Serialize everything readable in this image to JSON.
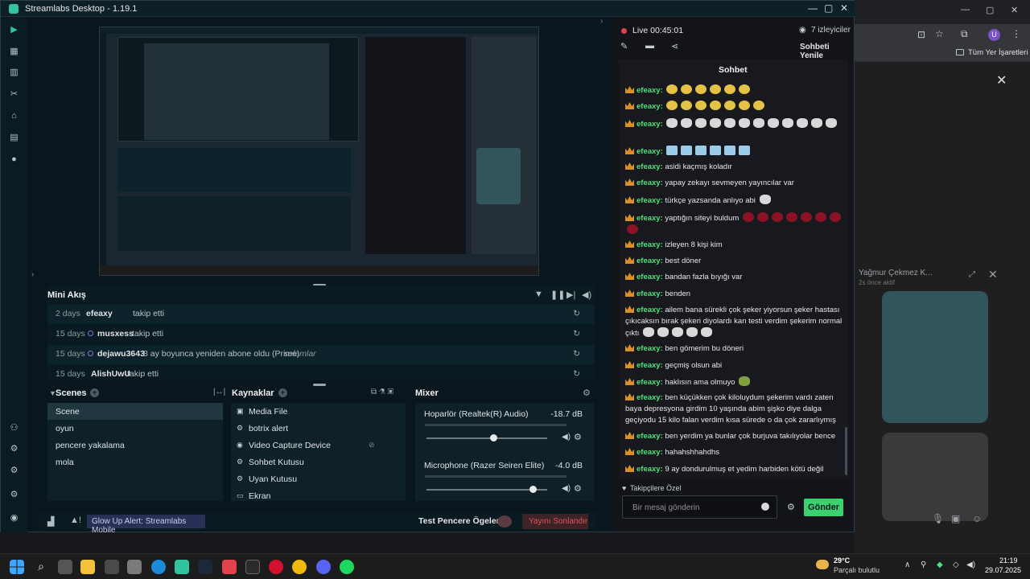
{
  "browser": {
    "bookmarks_label": "Tüm Yer İşaretleri",
    "profile_letter": "U",
    "card_title": "Yağmur Çekmez K...",
    "card_sub": "2s önce aktif"
  },
  "app": {
    "title": "Streamlabs Desktop - 1.19.1"
  },
  "minifeed": {
    "title": "Mini Akış",
    "rows": [
      {
        "age": "2 days",
        "user": "efeaxy",
        "action": "takip etti",
        "extra": ""
      },
      {
        "age": "15 days",
        "user": "musxess",
        "action": "takip etti",
        "extra": ""
      },
      {
        "age": "15 days",
        "user": "dejawu3643",
        "action": "8 ay boyunca yeniden abone oldu (Prime)",
        "extra": "selamlar"
      },
      {
        "age": "15 days",
        "user": "AlishUwU",
        "action": "takip etti",
        "extra": ""
      }
    ]
  },
  "scenes": {
    "title": "Scenes",
    "items": [
      "Scene",
      "oyun",
      "pencere yakalama",
      "mola"
    ],
    "selected": 0
  },
  "sources": {
    "title": "Kaynaklar",
    "items": [
      "Media File",
      "botrix alert",
      "Video Capture Device",
      "Sohbet Kutusu",
      "Uyan Kutusu",
      "Ekran"
    ]
  },
  "mixer": {
    "title": "Mixer",
    "channels": [
      {
        "name": "Hoparlör (Realtek(R) Audio)",
        "db": "-18.7 dB",
        "level": 0.55
      },
      {
        "name": "Microphone (Razer Seiren Elite)",
        "db": "-4.0 dB",
        "level": 0.88
      }
    ]
  },
  "footer": {
    "alert": "Glow Up Alert: Streamlabs Mobile",
    "test_label": "Test Pencere Ögeleri",
    "end_stream": "Yayını Sonlandır"
  },
  "stream": {
    "live": "Live 00:45:01",
    "viewers": "7 izleyiciler",
    "refresh": "Sohbeti Yenile",
    "chat_title": "Sohbet",
    "followers_only": "Takipçilere Özel",
    "input_placeholder": "Bir mesaj gönderin",
    "send": "Gönder"
  },
  "chat": [
    {
      "user": "efeaxy:",
      "text": "",
      "emotes": "yellow",
      "count": 6
    },
    {
      "user": "efeaxy:",
      "text": "",
      "emotes": "yellow",
      "count": 7
    },
    {
      "user": "efeaxy:",
      "text": "",
      "emotes": "duck",
      "count": 12
    },
    {
      "user": "efeaxy:",
      "text": "",
      "emotes": "peep",
      "count": 6
    },
    {
      "user": "efeaxy:",
      "text": "asidi kaçmış koladır",
      "emotes": "",
      "count": 0
    },
    {
      "user": "efeaxy:",
      "text": "yapay zekayı sevmeyen yayıncılar var",
      "emotes": "",
      "count": 0
    },
    {
      "user": "efeaxy:",
      "text": "türkçe yazsanda anlıyo abi",
      "emotes": "duck",
      "count": 1
    },
    {
      "user": "efeaxy:",
      "text": "yaptığın siteyi buldum",
      "emotes": "red",
      "count": 8
    },
    {
      "user": "efeaxy:",
      "text": "izleyen 8 kişi kim",
      "emotes": "",
      "count": 0
    },
    {
      "user": "efeaxy:",
      "text": "best döner",
      "emotes": "",
      "count": 0
    },
    {
      "user": "efeaxy:",
      "text": "bandan fazla bıyığı var",
      "emotes": "",
      "count": 0
    },
    {
      "user": "efeaxy:",
      "text": "benden",
      "emotes": "",
      "count": 0
    },
    {
      "user": "efeaxy:",
      "text": "ailem bana sürekli çok şeker yiyorsun şeker hastası çıkıcaksın bırak şekeri diyolardı kan testi verdim şekerim normal çıktı",
      "emotes": "duck",
      "count": 5
    },
    {
      "user": "efeaxy:",
      "text": "ben gömerim bu döneri",
      "emotes": "",
      "count": 0
    },
    {
      "user": "efeaxy:",
      "text": "geçmiş olsun abi",
      "emotes": "",
      "count": 0
    },
    {
      "user": "efeaxy:",
      "text": "haklısın ama olmuyo",
      "emotes": "green",
      "count": 1
    },
    {
      "user": "efeaxy:",
      "text": "ben küçükken çok kiloluydum şekerim vardı zaten baya depresyona girdim 10 yaşında abim şişko diye dalga geçiyodu 15 kilo falan verdim kısa sürede o da çok zararlıymış",
      "emotes": "",
      "count": 0
    },
    {
      "user": "efeaxy:",
      "text": "ben yerdim ya bunlar çok burjuva takılıyolar bence",
      "emotes": "",
      "count": 0
    },
    {
      "user": "efeaxy:",
      "text": "hahahshhahdhs",
      "emotes": "",
      "count": 0
    },
    {
      "user": "efeaxy:",
      "text": "9 ay dondurulmuş et yedim harbiden kötü değil",
      "emotes": "",
      "count": 0
    }
  ],
  "taskbar": {
    "temp": "29°C",
    "weather": "Parçalı bulutlu",
    "time": "21:19",
    "date": "29.07.2025"
  }
}
